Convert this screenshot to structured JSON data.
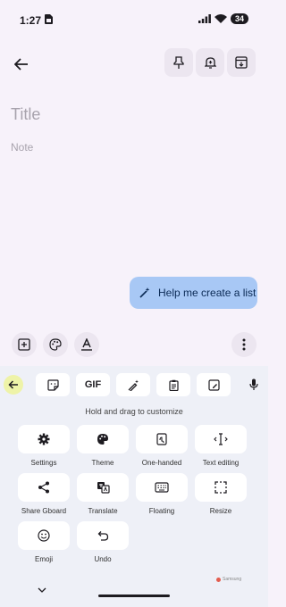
{
  "status_bar": {
    "time": "1:27",
    "battery": "34"
  },
  "editor": {
    "title_placeholder": "Title",
    "note_placeholder": "Note",
    "help_button_label": "Help me create a list"
  },
  "keyboard": {
    "gif_label": "GIF",
    "hint": "Hold and drag to customize",
    "tiles": [
      {
        "label": "Settings",
        "icon": "gear-icon"
      },
      {
        "label": "Theme",
        "icon": "palette-icon"
      },
      {
        "label": "One-handed",
        "icon": "one-handed-icon"
      },
      {
        "label": "Text editing",
        "icon": "text-cursor-icon"
      },
      {
        "label": "Share Gboard",
        "icon": "share-icon"
      },
      {
        "label": "Translate",
        "icon": "translate-icon"
      },
      {
        "label": "Floating",
        "icon": "floating-keyboard-icon"
      },
      {
        "label": "Resize",
        "icon": "resize-icon"
      },
      {
        "label": "Emoji",
        "icon": "emoji-icon"
      },
      {
        "label": "Undo",
        "icon": "undo-icon"
      }
    ],
    "brand": "Samsung"
  },
  "colors": {
    "background": "#f7f2fa",
    "accent_pill": "#a8c8f5",
    "keyboard_bg": "#eef0f7",
    "back_key": "#eef3a8"
  }
}
